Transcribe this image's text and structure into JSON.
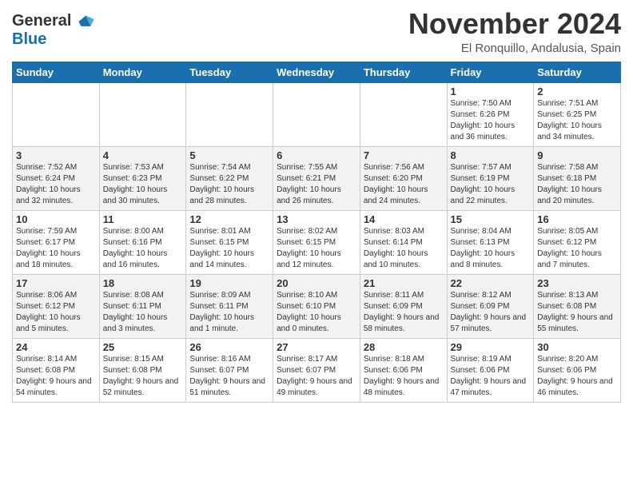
{
  "header": {
    "logo_line1": "General",
    "logo_line2": "Blue",
    "month_title": "November 2024",
    "location": "El Ronquillo, Andalusia, Spain"
  },
  "weekdays": [
    "Sunday",
    "Monday",
    "Tuesday",
    "Wednesday",
    "Thursday",
    "Friday",
    "Saturday"
  ],
  "weeks": [
    [
      {
        "day": "",
        "info": ""
      },
      {
        "day": "",
        "info": ""
      },
      {
        "day": "",
        "info": ""
      },
      {
        "day": "",
        "info": ""
      },
      {
        "day": "",
        "info": ""
      },
      {
        "day": "1",
        "info": "Sunrise: 7:50 AM\nSunset: 6:26 PM\nDaylight: 10 hours and 36 minutes."
      },
      {
        "day": "2",
        "info": "Sunrise: 7:51 AM\nSunset: 6:25 PM\nDaylight: 10 hours and 34 minutes."
      }
    ],
    [
      {
        "day": "3",
        "info": "Sunrise: 7:52 AM\nSunset: 6:24 PM\nDaylight: 10 hours and 32 minutes."
      },
      {
        "day": "4",
        "info": "Sunrise: 7:53 AM\nSunset: 6:23 PM\nDaylight: 10 hours and 30 minutes."
      },
      {
        "day": "5",
        "info": "Sunrise: 7:54 AM\nSunset: 6:22 PM\nDaylight: 10 hours and 28 minutes."
      },
      {
        "day": "6",
        "info": "Sunrise: 7:55 AM\nSunset: 6:21 PM\nDaylight: 10 hours and 26 minutes."
      },
      {
        "day": "7",
        "info": "Sunrise: 7:56 AM\nSunset: 6:20 PM\nDaylight: 10 hours and 24 minutes."
      },
      {
        "day": "8",
        "info": "Sunrise: 7:57 AM\nSunset: 6:19 PM\nDaylight: 10 hours and 22 minutes."
      },
      {
        "day": "9",
        "info": "Sunrise: 7:58 AM\nSunset: 6:18 PM\nDaylight: 10 hours and 20 minutes."
      }
    ],
    [
      {
        "day": "10",
        "info": "Sunrise: 7:59 AM\nSunset: 6:17 PM\nDaylight: 10 hours and 18 minutes."
      },
      {
        "day": "11",
        "info": "Sunrise: 8:00 AM\nSunset: 6:16 PM\nDaylight: 10 hours and 16 minutes."
      },
      {
        "day": "12",
        "info": "Sunrise: 8:01 AM\nSunset: 6:15 PM\nDaylight: 10 hours and 14 minutes."
      },
      {
        "day": "13",
        "info": "Sunrise: 8:02 AM\nSunset: 6:15 PM\nDaylight: 10 hours and 12 minutes."
      },
      {
        "day": "14",
        "info": "Sunrise: 8:03 AM\nSunset: 6:14 PM\nDaylight: 10 hours and 10 minutes."
      },
      {
        "day": "15",
        "info": "Sunrise: 8:04 AM\nSunset: 6:13 PM\nDaylight: 10 hours and 8 minutes."
      },
      {
        "day": "16",
        "info": "Sunrise: 8:05 AM\nSunset: 6:12 PM\nDaylight: 10 hours and 7 minutes."
      }
    ],
    [
      {
        "day": "17",
        "info": "Sunrise: 8:06 AM\nSunset: 6:12 PM\nDaylight: 10 hours and 5 minutes."
      },
      {
        "day": "18",
        "info": "Sunrise: 8:08 AM\nSunset: 6:11 PM\nDaylight: 10 hours and 3 minutes."
      },
      {
        "day": "19",
        "info": "Sunrise: 8:09 AM\nSunset: 6:11 PM\nDaylight: 10 hours and 1 minute."
      },
      {
        "day": "20",
        "info": "Sunrise: 8:10 AM\nSunset: 6:10 PM\nDaylight: 10 hours and 0 minutes."
      },
      {
        "day": "21",
        "info": "Sunrise: 8:11 AM\nSunset: 6:09 PM\nDaylight: 9 hours and 58 minutes."
      },
      {
        "day": "22",
        "info": "Sunrise: 8:12 AM\nSunset: 6:09 PM\nDaylight: 9 hours and 57 minutes."
      },
      {
        "day": "23",
        "info": "Sunrise: 8:13 AM\nSunset: 6:08 PM\nDaylight: 9 hours and 55 minutes."
      }
    ],
    [
      {
        "day": "24",
        "info": "Sunrise: 8:14 AM\nSunset: 6:08 PM\nDaylight: 9 hours and 54 minutes."
      },
      {
        "day": "25",
        "info": "Sunrise: 8:15 AM\nSunset: 6:08 PM\nDaylight: 9 hours and 52 minutes."
      },
      {
        "day": "26",
        "info": "Sunrise: 8:16 AM\nSunset: 6:07 PM\nDaylight: 9 hours and 51 minutes."
      },
      {
        "day": "27",
        "info": "Sunrise: 8:17 AM\nSunset: 6:07 PM\nDaylight: 9 hours and 49 minutes."
      },
      {
        "day": "28",
        "info": "Sunrise: 8:18 AM\nSunset: 6:06 PM\nDaylight: 9 hours and 48 minutes."
      },
      {
        "day": "29",
        "info": "Sunrise: 8:19 AM\nSunset: 6:06 PM\nDaylight: 9 hours and 47 minutes."
      },
      {
        "day": "30",
        "info": "Sunrise: 8:20 AM\nSunset: 6:06 PM\nDaylight: 9 hours and 46 minutes."
      }
    ]
  ]
}
